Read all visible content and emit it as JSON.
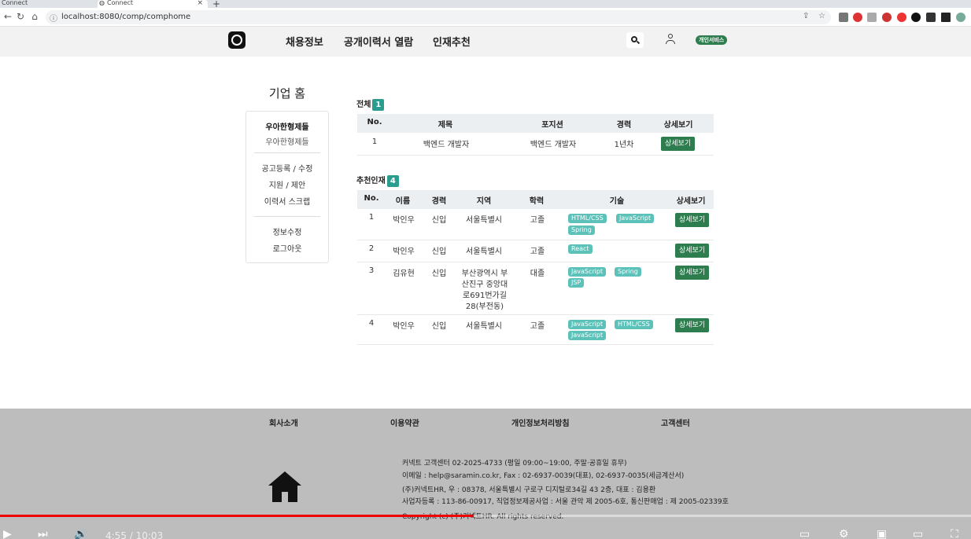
{
  "browser": {
    "tabs": [
      {
        "title": "Connect"
      },
      {
        "title": "Connect"
      }
    ],
    "new_tab": "+",
    "close": "×",
    "url": "localhost:8080/comp/comphome"
  },
  "header": {
    "nav": [
      "채용정보",
      "공개이력서 열람",
      "인재추천"
    ],
    "badge": "개인서비스"
  },
  "sidebar": {
    "title": "기업 홈",
    "company_name": "우아한형제들",
    "company_sub": "우아한형제들",
    "menu1": [
      "공고등록 / 수정",
      "지원 / 제안",
      "이력서 스크랩"
    ],
    "menu2": [
      "정보수정",
      "로그아웃"
    ]
  },
  "jobs": {
    "label": "전체",
    "count": "1",
    "headers": [
      "No.",
      "제목",
      "포지션",
      "경력",
      "상세보기"
    ],
    "rows": [
      {
        "no": "1",
        "title": "백엔드 개발자",
        "position": "백엔드 개발자",
        "career": "1년차",
        "button": "상세보기"
      }
    ]
  },
  "talents": {
    "label": "추천인재",
    "count": "4",
    "headers": [
      "No.",
      "이름",
      "경력",
      "지역",
      "학력",
      "기술",
      "상세보기"
    ],
    "rows": [
      {
        "no": "1",
        "name": "박인우",
        "career": "신입",
        "region": [
          "서울특별시"
        ],
        "edu": "고졸",
        "skills": [
          "HTML/CSS",
          "JavaScript",
          "Spring"
        ],
        "button": "상세보기"
      },
      {
        "no": "2",
        "name": "박인우",
        "career": "신입",
        "region": [
          "서울특별시"
        ],
        "edu": "고졸",
        "skills": [
          "React"
        ],
        "button": "상세보기"
      },
      {
        "no": "3",
        "name": "김유현",
        "career": "신입",
        "region": [
          "부산광역시 부",
          "산진구 중앙대",
          "로691번가길",
          "28(부전동)"
        ],
        "edu": "대졸",
        "skills": [
          "JavaScript",
          "Spring",
          "JSP"
        ],
        "button": "상세보기"
      },
      {
        "no": "4",
        "name": "박인우",
        "career": "신입",
        "region": [
          "서울특별시"
        ],
        "edu": "고졸",
        "skills": [
          "JavaScript",
          "HTML/CSS",
          "JavaScript"
        ],
        "button": "상세보기"
      }
    ]
  },
  "footer": {
    "links": [
      "회사소개",
      "이용약관",
      "개인정보처리방침",
      "고객센터"
    ],
    "info": [
      "커넥트 고객센터 02-2025-4733 (평일 09:00~19:00, 주말·공휴일 휴무)",
      "이메일 : help@saramin.co.kr, Fax : 02-6937-0039(대표), 02-6937-0035(세금계산서)",
      "(주)커넥트HR, 우 : 08378, 서울특별시 구로구 디지털로34길 43 2층, 대표 : 김용환",
      "사업자등록 : 113-86-00917, 직업정보제공사업 : 서울 관악 제 2005-6호, 통신판매업 : 제 2005-02339호",
      "Copyright (c) (주)커넥트HR. All rights reserved."
    ]
  },
  "video": {
    "time": "4:55 / 10:03",
    "progress": 0.488
  },
  "colors": {
    "accent_green": "#2e7d4f",
    "skill_teal": "#5cc1b8",
    "count_badge": "#2a9d8f",
    "progress_red": "#ee0000"
  }
}
